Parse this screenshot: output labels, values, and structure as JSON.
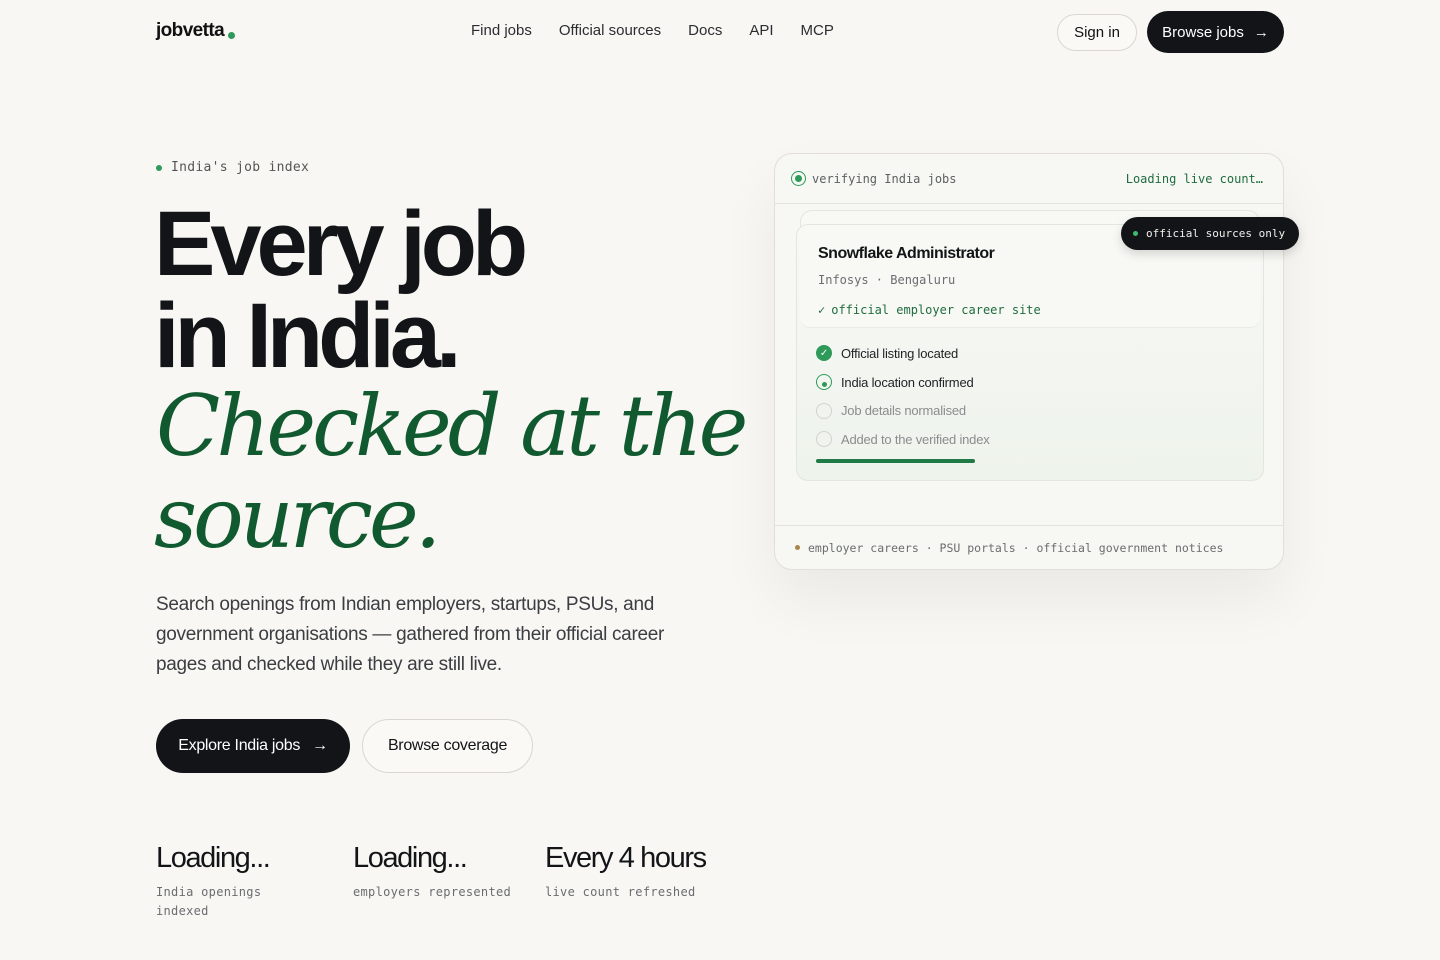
{
  "header": {
    "logo": "jobvetta",
    "nav": [
      "Find jobs",
      "Official sources",
      "Docs",
      "API",
      "MCP"
    ],
    "sign_in": "Sign in",
    "browse_jobs": "Browse jobs",
    "arrow": "→"
  },
  "hero": {
    "eyebrow": "India's job index",
    "headline_line1": "Every job",
    "headline_line2": "in India.",
    "headline_line3": "Checked at the",
    "headline_line4": "source.",
    "lede": "Search openings from Indian employers, startups, PSUs, and government organisations — gathered from their official career pages and checked while they are still live.",
    "cta_primary": "Explore India jobs",
    "cta_secondary": "Browse coverage"
  },
  "stats": [
    {
      "value": "Loading...",
      "label": "India openings indexed"
    },
    {
      "value": "Loading...",
      "label": "employers represented"
    },
    {
      "value": "Every 4 hours",
      "label": "live count refreshed"
    }
  ],
  "panel": {
    "status": "verifying India jobs",
    "live_count": "Loading live count…",
    "badge": "official sources only",
    "job": {
      "title": "Snowflake Administrator",
      "company_location": "Infosys · Bengaluru",
      "source": "official employer career site"
    },
    "steps": [
      {
        "label": "Official listing located",
        "state": "done"
      },
      {
        "label": "India location confirmed",
        "state": "active"
      },
      {
        "label": "Job details normalised",
        "state": "pending"
      },
      {
        "label": "Added to the verified index",
        "state": "pending"
      }
    ],
    "progress_fraction": 0.34,
    "footer": "employer careers · PSU portals · official government notices"
  },
  "colors": {
    "accent_green": "#2e9a5a",
    "headline_green": "#11592f",
    "dark": "#121418",
    "background": "#f8f7f3"
  },
  "icons": {
    "arrow": "arrow-right-icon",
    "check": "check-icon",
    "status": "radio-ring-icon"
  }
}
